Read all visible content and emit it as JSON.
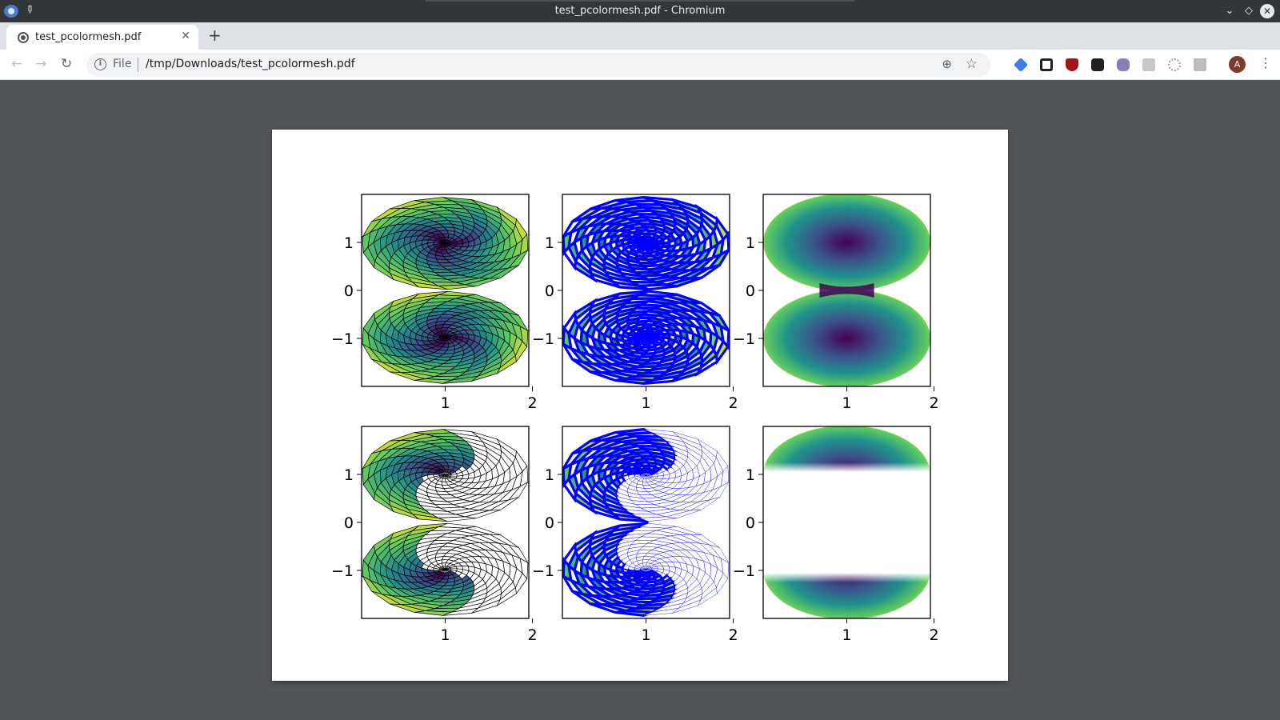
{
  "window": {
    "title": "test_pcolormesh.pdf - Chromium",
    "minimize_glyph": "⌄",
    "maximize_glyph": "◇",
    "close_glyph": "✕"
  },
  "tabs": [
    {
      "title": "test_pcolormesh.pdf",
      "close_glyph": "✕",
      "active": true
    }
  ],
  "newtab_glyph": "+",
  "toolbar": {
    "back_glyph": "←",
    "forward_glyph": "→",
    "reload_glyph": "↻",
    "scheme": "File",
    "url": "/tmp/Downloads/test_pcolormesh.pdf",
    "zoom_glyph": "⊕",
    "star_glyph": "☆",
    "avatar_letter": "A",
    "menu_glyph": "⋮",
    "extensions": [
      "graduation-cap-icon",
      "square-icon",
      "ublock-icon",
      "mask-icon",
      "cat-icon",
      "puzzle-icon",
      "dots-icon",
      "extension-icon"
    ]
  },
  "colors": {
    "mesh_blue": "#0000ff",
    "viridis": [
      "#440154",
      "#3b528b",
      "#21918c",
      "#5ec962",
      "#fde725"
    ]
  },
  "chart_data": [
    {
      "type": "heatmap",
      "panel": "top-left",
      "style": "shaded mesh with black edges",
      "xticks": [
        "1",
        "2"
      ],
      "yticks": [
        "1",
        "0",
        "−1"
      ]
    },
    {
      "type": "heatmap",
      "panel": "top-middle",
      "style": "mesh with thick blue edges",
      "xticks": [
        "1",
        "2"
      ],
      "yticks": [
        "1",
        "0",
        "−1"
      ]
    },
    {
      "type": "heatmap",
      "panel": "top-right",
      "style": "gouraud shading",
      "xticks": [
        "1",
        "2"
      ],
      "yticks": [
        "1",
        "0",
        "−1"
      ]
    },
    {
      "type": "heatmap",
      "panel": "bottom-left",
      "style": "masked mesh with black edges",
      "xticks": [
        "1",
        "2"
      ],
      "yticks": [
        "1",
        "0",
        "−1"
      ]
    },
    {
      "type": "heatmap",
      "panel": "bottom-middle",
      "style": "masked mesh with blue edges",
      "xticks": [
        "1",
        "2"
      ],
      "yticks": [
        "1",
        "0",
        "−1"
      ]
    },
    {
      "type": "heatmap",
      "panel": "bottom-right",
      "style": "masked gouraud shading",
      "xticks": [
        "1",
        "2"
      ],
      "yticks": [
        "1",
        "0",
        "−1"
      ]
    }
  ]
}
